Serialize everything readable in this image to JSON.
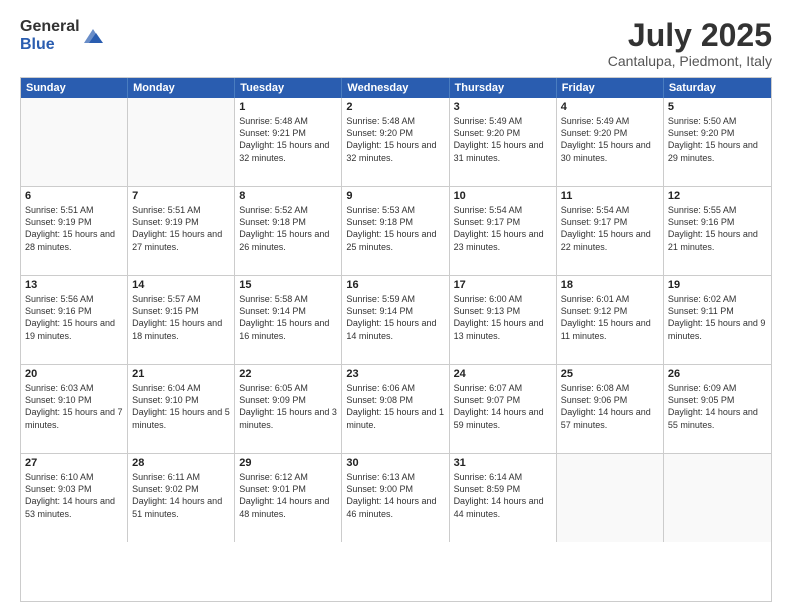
{
  "logo": {
    "general": "General",
    "blue": "Blue"
  },
  "title": {
    "month_year": "July 2025",
    "location": "Cantalupa, Piedmont, Italy"
  },
  "header_days": [
    "Sunday",
    "Monday",
    "Tuesday",
    "Wednesday",
    "Thursday",
    "Friday",
    "Saturday"
  ],
  "weeks": [
    [
      {
        "day": "",
        "sunrise": "",
        "sunset": "",
        "daylight": "",
        "empty": true
      },
      {
        "day": "",
        "sunrise": "",
        "sunset": "",
        "daylight": "",
        "empty": true
      },
      {
        "day": "1",
        "sunrise": "Sunrise: 5:48 AM",
        "sunset": "Sunset: 9:21 PM",
        "daylight": "Daylight: 15 hours and 32 minutes."
      },
      {
        "day": "2",
        "sunrise": "Sunrise: 5:48 AM",
        "sunset": "Sunset: 9:20 PM",
        "daylight": "Daylight: 15 hours and 32 minutes."
      },
      {
        "day": "3",
        "sunrise": "Sunrise: 5:49 AM",
        "sunset": "Sunset: 9:20 PM",
        "daylight": "Daylight: 15 hours and 31 minutes."
      },
      {
        "day": "4",
        "sunrise": "Sunrise: 5:49 AM",
        "sunset": "Sunset: 9:20 PM",
        "daylight": "Daylight: 15 hours and 30 minutes."
      },
      {
        "day": "5",
        "sunrise": "Sunrise: 5:50 AM",
        "sunset": "Sunset: 9:20 PM",
        "daylight": "Daylight: 15 hours and 29 minutes."
      }
    ],
    [
      {
        "day": "6",
        "sunrise": "Sunrise: 5:51 AM",
        "sunset": "Sunset: 9:19 PM",
        "daylight": "Daylight: 15 hours and 28 minutes."
      },
      {
        "day": "7",
        "sunrise": "Sunrise: 5:51 AM",
        "sunset": "Sunset: 9:19 PM",
        "daylight": "Daylight: 15 hours and 27 minutes."
      },
      {
        "day": "8",
        "sunrise": "Sunrise: 5:52 AM",
        "sunset": "Sunset: 9:18 PM",
        "daylight": "Daylight: 15 hours and 26 minutes."
      },
      {
        "day": "9",
        "sunrise": "Sunrise: 5:53 AM",
        "sunset": "Sunset: 9:18 PM",
        "daylight": "Daylight: 15 hours and 25 minutes."
      },
      {
        "day": "10",
        "sunrise": "Sunrise: 5:54 AM",
        "sunset": "Sunset: 9:17 PM",
        "daylight": "Daylight: 15 hours and 23 minutes."
      },
      {
        "day": "11",
        "sunrise": "Sunrise: 5:54 AM",
        "sunset": "Sunset: 9:17 PM",
        "daylight": "Daylight: 15 hours and 22 minutes."
      },
      {
        "day": "12",
        "sunrise": "Sunrise: 5:55 AM",
        "sunset": "Sunset: 9:16 PM",
        "daylight": "Daylight: 15 hours and 21 minutes."
      }
    ],
    [
      {
        "day": "13",
        "sunrise": "Sunrise: 5:56 AM",
        "sunset": "Sunset: 9:16 PM",
        "daylight": "Daylight: 15 hours and 19 minutes."
      },
      {
        "day": "14",
        "sunrise": "Sunrise: 5:57 AM",
        "sunset": "Sunset: 9:15 PM",
        "daylight": "Daylight: 15 hours and 18 minutes."
      },
      {
        "day": "15",
        "sunrise": "Sunrise: 5:58 AM",
        "sunset": "Sunset: 9:14 PM",
        "daylight": "Daylight: 15 hours and 16 minutes."
      },
      {
        "day": "16",
        "sunrise": "Sunrise: 5:59 AM",
        "sunset": "Sunset: 9:14 PM",
        "daylight": "Daylight: 15 hours and 14 minutes."
      },
      {
        "day": "17",
        "sunrise": "Sunrise: 6:00 AM",
        "sunset": "Sunset: 9:13 PM",
        "daylight": "Daylight: 15 hours and 13 minutes."
      },
      {
        "day": "18",
        "sunrise": "Sunrise: 6:01 AM",
        "sunset": "Sunset: 9:12 PM",
        "daylight": "Daylight: 15 hours and 11 minutes."
      },
      {
        "day": "19",
        "sunrise": "Sunrise: 6:02 AM",
        "sunset": "Sunset: 9:11 PM",
        "daylight": "Daylight: 15 hours and 9 minutes."
      }
    ],
    [
      {
        "day": "20",
        "sunrise": "Sunrise: 6:03 AM",
        "sunset": "Sunset: 9:10 PM",
        "daylight": "Daylight: 15 hours and 7 minutes."
      },
      {
        "day": "21",
        "sunrise": "Sunrise: 6:04 AM",
        "sunset": "Sunset: 9:10 PM",
        "daylight": "Daylight: 15 hours and 5 minutes."
      },
      {
        "day": "22",
        "sunrise": "Sunrise: 6:05 AM",
        "sunset": "Sunset: 9:09 PM",
        "daylight": "Daylight: 15 hours and 3 minutes."
      },
      {
        "day": "23",
        "sunrise": "Sunrise: 6:06 AM",
        "sunset": "Sunset: 9:08 PM",
        "daylight": "Daylight: 15 hours and 1 minute."
      },
      {
        "day": "24",
        "sunrise": "Sunrise: 6:07 AM",
        "sunset": "Sunset: 9:07 PM",
        "daylight": "Daylight: 14 hours and 59 minutes."
      },
      {
        "day": "25",
        "sunrise": "Sunrise: 6:08 AM",
        "sunset": "Sunset: 9:06 PM",
        "daylight": "Daylight: 14 hours and 57 minutes."
      },
      {
        "day": "26",
        "sunrise": "Sunrise: 6:09 AM",
        "sunset": "Sunset: 9:05 PM",
        "daylight": "Daylight: 14 hours and 55 minutes."
      }
    ],
    [
      {
        "day": "27",
        "sunrise": "Sunrise: 6:10 AM",
        "sunset": "Sunset: 9:03 PM",
        "daylight": "Daylight: 14 hours and 53 minutes."
      },
      {
        "day": "28",
        "sunrise": "Sunrise: 6:11 AM",
        "sunset": "Sunset: 9:02 PM",
        "daylight": "Daylight: 14 hours and 51 minutes."
      },
      {
        "day": "29",
        "sunrise": "Sunrise: 6:12 AM",
        "sunset": "Sunset: 9:01 PM",
        "daylight": "Daylight: 14 hours and 48 minutes."
      },
      {
        "day": "30",
        "sunrise": "Sunrise: 6:13 AM",
        "sunset": "Sunset: 9:00 PM",
        "daylight": "Daylight: 14 hours and 46 minutes."
      },
      {
        "day": "31",
        "sunrise": "Sunrise: 6:14 AM",
        "sunset": "Sunset: 8:59 PM",
        "daylight": "Daylight: 14 hours and 44 minutes."
      },
      {
        "day": "",
        "sunrise": "",
        "sunset": "",
        "daylight": "",
        "empty": true
      },
      {
        "day": "",
        "sunrise": "",
        "sunset": "",
        "daylight": "",
        "empty": true
      }
    ]
  ]
}
